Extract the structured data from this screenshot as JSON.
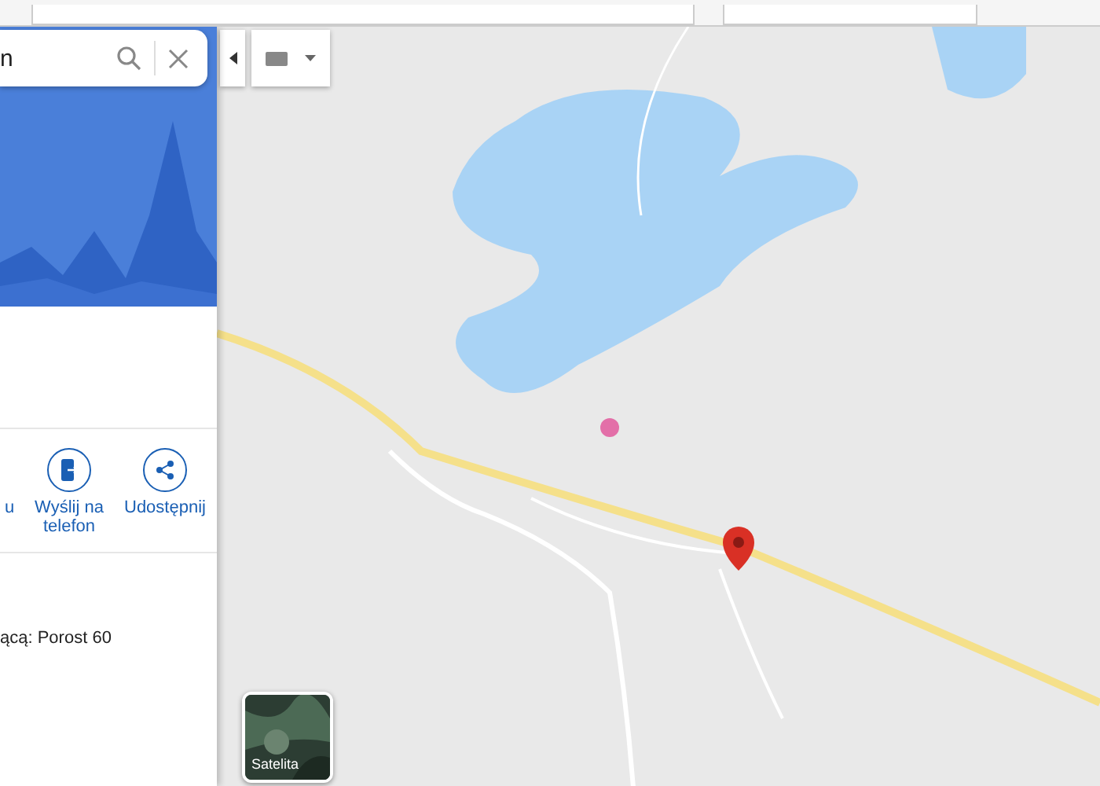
{
  "search": {
    "value": "n"
  },
  "actions": [
    {
      "label": "u",
      "kind": "plain"
    },
    {
      "label": "Wyślij na telefon",
      "kind": "phone"
    },
    {
      "label": "Udostępnij",
      "kind": "share"
    }
  ],
  "details": [
    {
      "text": "ącą: Porost 60"
    }
  ],
  "layer_switch": {
    "label": "Satelita"
  }
}
